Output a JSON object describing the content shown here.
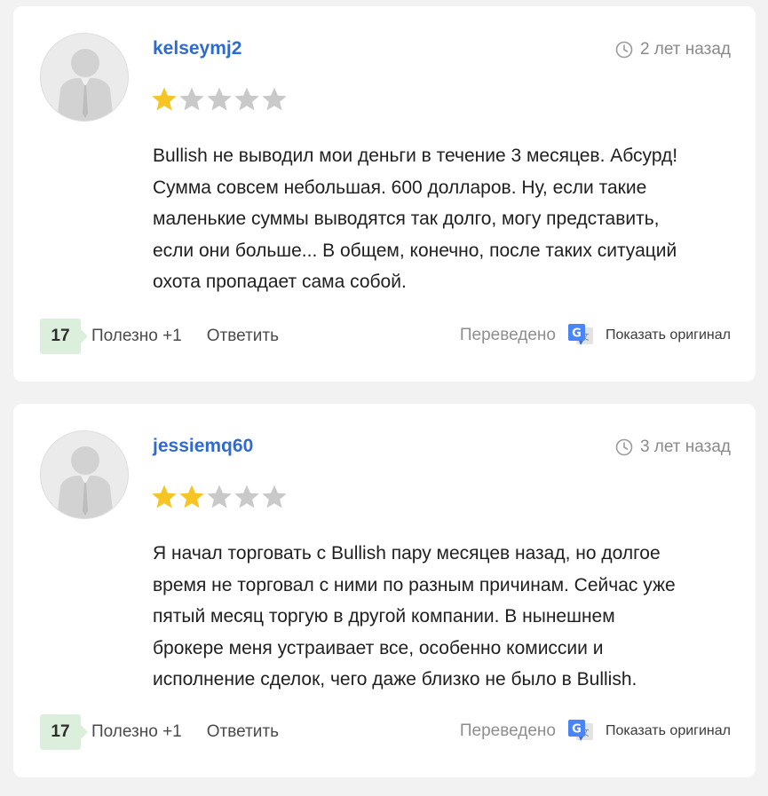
{
  "reviews": [
    {
      "username": "kelseymj2",
      "time": "2 лет назад",
      "rating": 1,
      "max_rating": 5,
      "lines": [
        "Bullish не выводил мои деньги в течение 3 месяцев. Абсурд!",
        "Сумма совсем небольшая. 600 долларов. Ну, если такие",
        "маленькие суммы выводятся так долго, могу представить,",
        "если они больше... В общем, конечно, после таких ситуаций",
        "охота пропадает сама собой."
      ],
      "helpful_count": "17",
      "useful_label": "Полезно +1",
      "reply_label": "Ответить",
      "translated_label": "Переведено",
      "show_original_label": "Показать оригинал"
    },
    {
      "username": "jessiemq60",
      "time": "3 лет назад",
      "rating": 2,
      "max_rating": 5,
      "lines": [
        "Я начал торговать с Bullish пару месяцев назад, но долгое",
        "время не торговал с ними по разным причинам. Сейчас уже",
        "пятый месяц торгую в другой компании. В нынешнем",
        "брокере меня устраивает все, особенно комиссии и",
        "исполнение сделок, чего даже близко не было в Bullish."
      ],
      "helpful_count": "17",
      "useful_label": "Полезно +1",
      "reply_label": "Ответить",
      "translated_label": "Переведено",
      "show_original_label": "Показать оригинал"
    }
  ],
  "colors": {
    "star_filled": "#f6c523",
    "star_empty": "#c9c9c9",
    "username": "#2f6bcf",
    "badge_bg": "#dcefdc"
  },
  "icons": {
    "avatar": "default-user-avatar",
    "clock": "clock-icon",
    "translate": "google-translate-icon"
  }
}
